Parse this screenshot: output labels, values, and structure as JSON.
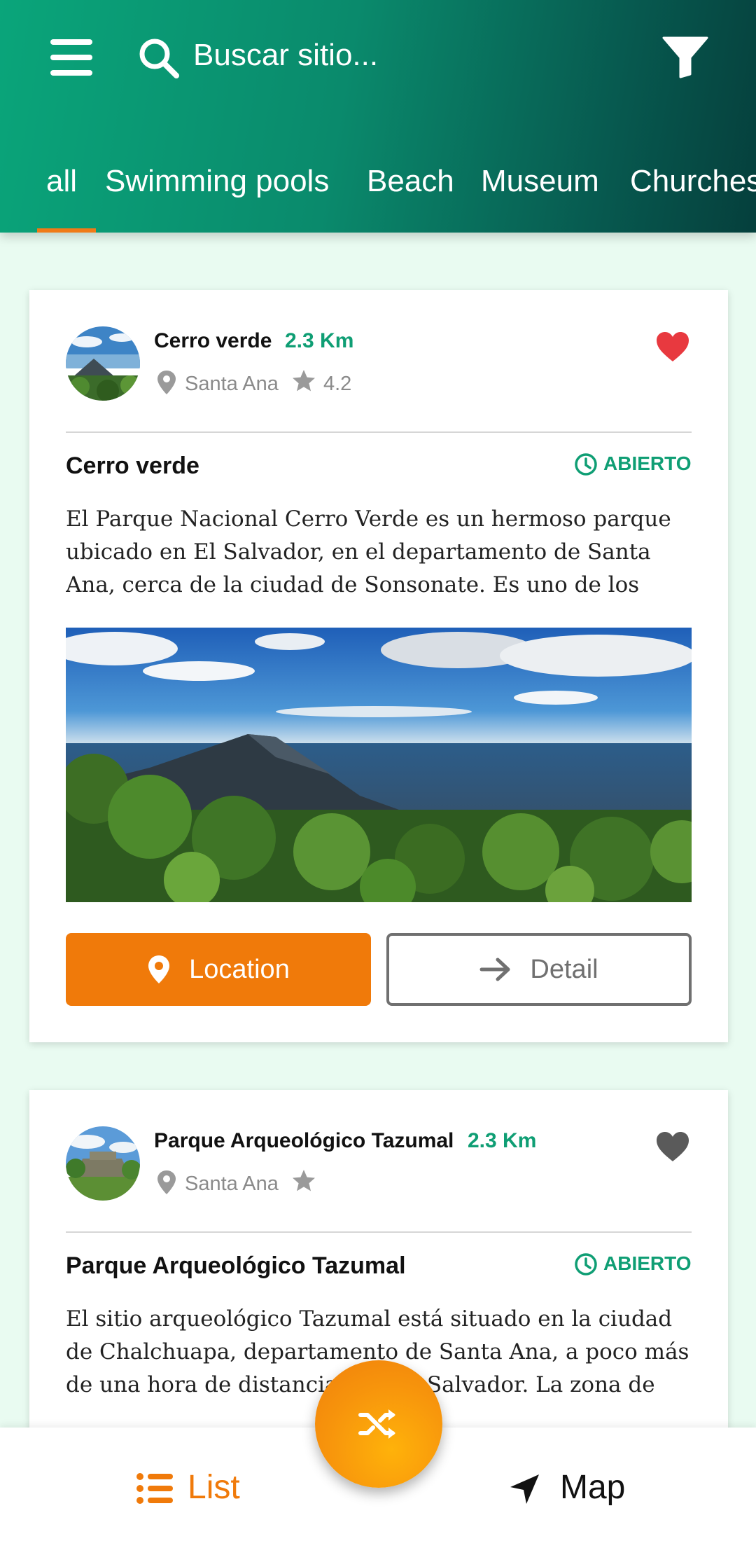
{
  "header": {
    "search_placeholder": "Buscar sitio...",
    "tabs": [
      {
        "label": "all",
        "active": true
      },
      {
        "label": "Swimming pools"
      },
      {
        "label": "Beach"
      },
      {
        "label": "Museum"
      },
      {
        "label": "Churches"
      }
    ]
  },
  "places": [
    {
      "name": "Cerro verde",
      "distance": "2.3 Km",
      "city": "Santa Ana",
      "rating": "4.2",
      "favorite": true,
      "title": "Cerro verde",
      "status": "ABIERTO",
      "description": "El Parque Nacional Cerro Verde es un hermoso parque ubicado en El Salvador, en el departamento de Santa Ana, cerca de la ciudad de Sonsonate. Es uno de los parques naturales más populares y visitados de El Salvador, debido a",
      "location_label": "Location",
      "detail_label": "Detail"
    },
    {
      "name": "Parque Arqueológico Tazumal",
      "distance": "2.3 Km",
      "city": "Santa Ana",
      "rating": "",
      "favorite": false,
      "title": "Parque Arqueológico Tazumal",
      "status": "ABIERTO",
      "description": "El sitio arqueológico Tazumal está situado en la ciudad de Chalchuapa, departamento de Santa Ana, a poco más de una hora de distancia de San Salvador. La zona de Chalchuapa constituye uno de los grandes asentamientos"
    }
  ],
  "bottom_nav": {
    "list_label": "List",
    "map_label": "Map"
  },
  "colors": {
    "accent_orange": "#f07a0a",
    "primary_green": "#0aa57a",
    "open_green": "#0f9e74",
    "heart_red": "#e8393f"
  }
}
